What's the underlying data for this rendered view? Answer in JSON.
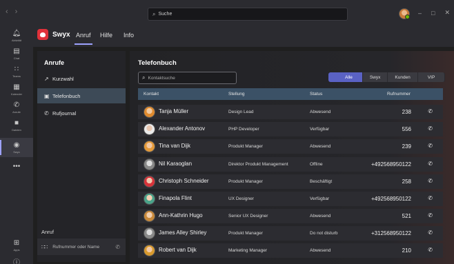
{
  "titlebar": {
    "search_placeholder": "Suche",
    "minimize": "–",
    "maximize": "□",
    "close": "✕"
  },
  "rail": {
    "items": [
      {
        "label": "Aktivität",
        "icon": "bell-icon"
      },
      {
        "label": "Chat",
        "icon": "chat-icon"
      },
      {
        "label": "Teams",
        "icon": "teams-icon"
      },
      {
        "label": "Kalender",
        "icon": "calendar-icon"
      },
      {
        "label": "Anrufe",
        "icon": "phone-icon"
      },
      {
        "label": "Dateien",
        "icon": "file-icon"
      },
      {
        "label": "Swyx",
        "icon": "swyx-icon"
      },
      {
        "label": "Apps",
        "icon": "apps-icon"
      }
    ],
    "more": "•••"
  },
  "app": {
    "name": "Swyx",
    "tabs": [
      "Anruf",
      "Hilfe",
      "Info"
    ]
  },
  "leftpanel": {
    "title": "Anrufe",
    "items": [
      "Kurzwahl",
      "Telefonbuch",
      "Rufjournal"
    ],
    "call_label": "Anruf",
    "dial_placeholder": "Rufnummer oder Name"
  },
  "main": {
    "title": "Telefonbuch",
    "search_placeholder": "Kontaktsuche",
    "filters": [
      "Alle",
      "Swyx",
      "Kunden",
      "VIP"
    ],
    "columns": [
      "Kontakt",
      "Stellung",
      "Status",
      "Rufnummer"
    ],
    "rows": [
      {
        "name": "Tanja Müller",
        "role": "Design Lead",
        "status": "Abwesend",
        "number": "238"
      },
      {
        "name": "Alexander Antonov",
        "role": "PHP Developer",
        "status": "Verfügbar",
        "number": "556"
      },
      {
        "name": "Tina van Dijk",
        "role": "Produkt Manager",
        "status": "Abwesend",
        "number": "239"
      },
      {
        "name": "Nil Karaoglan",
        "role": "Direktor Produkt Management",
        "status": "Offline",
        "number": "+492568950122"
      },
      {
        "name": "Christoph Schneider",
        "role": "Produkt Manager",
        "status": "Beschäftigt",
        "number": "258"
      },
      {
        "name": "Finapola Flint",
        "role": "UX Designer",
        "status": "Verfügbar",
        "number": "+492568950122"
      },
      {
        "name": "Ann-Kathrin Hugo",
        "role": "Senior UX Designer",
        "status": "Abwesend",
        "number": "521"
      },
      {
        "name": "James Alley Shirley",
        "role": "Produkt Manager",
        "status": "Do not disturb",
        "number": "+312568950122"
      },
      {
        "name": "Robert van Dijk",
        "role": "Marketing Manager",
        "status": "Abwesend",
        "number": "210"
      }
    ]
  },
  "colors": {
    "accent": "#5a62c4",
    "header_row": "#3b5166",
    "selected_item": "#3d4a57",
    "swyx_red": "#e0313a"
  }
}
